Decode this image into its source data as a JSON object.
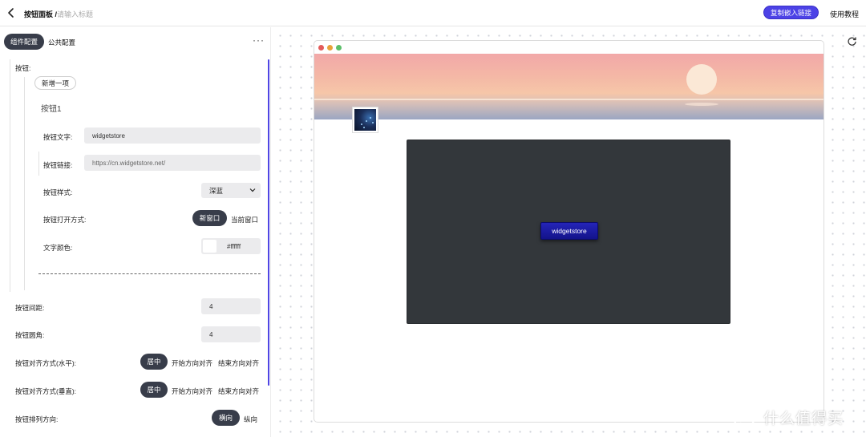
{
  "header": {
    "title": "按钮面板 /",
    "title_placeholder": "请输入标题",
    "embed_button": "复制嵌入链接",
    "tutorial_link": "使用教程"
  },
  "left_panel": {
    "tabs": [
      {
        "label": "组件配置",
        "active": true
      },
      {
        "label": "公共配置",
        "active": false
      }
    ],
    "more_icon": "ellipsis-icon",
    "buttons_label": "按钮:",
    "add_item": "新增一项",
    "item_name": "按钮1",
    "item_fields": {
      "text_label": "按钮文字:",
      "text_value": "widgetstore",
      "link_label": "按钮链接:",
      "link_value": "https://cn.widgetstore.net/",
      "style_label": "按钮样式:",
      "style_value": "深蓝",
      "open_label": "按钮打开方式:",
      "open_options": [
        "新窗口",
        "当前窗口"
      ],
      "open_selected": "新窗口",
      "color_label": "文字颜色:",
      "color_value": "#ffffff"
    },
    "spacing_label": "按钮间距:",
    "spacing_value": "4",
    "radius_label": "按钮圆角:",
    "radius_value": "4",
    "align_h_label": "按钮对齐方式(水平):",
    "align_h_options": [
      "居中",
      "开始方向对齐",
      "结束方向对齐"
    ],
    "align_h_selected": "居中",
    "align_v_label": "按钮对齐方式(垂直):",
    "align_v_options": [
      "居中",
      "开始方向对齐",
      "结束方向对齐"
    ],
    "align_v_selected": "居中",
    "direction_label": "按钮排列方向:",
    "direction_options": [
      "横向",
      "纵向"
    ],
    "direction_selected": "横向"
  },
  "preview": {
    "refresh_icon": "refresh-icon",
    "window_dots": [
      "#e35b5b",
      "#e8a23a",
      "#5cbf6a"
    ],
    "button_label": "widgetstore",
    "button_color": "#1a1aa3",
    "panel_color": "#33373b"
  },
  "watermark": {
    "text": "什么值得买",
    "logo": "smzdm-logo"
  },
  "colors": {
    "accent": "#4c42e6",
    "segment_active": "#383d4a",
    "input_bg": "#ebebed"
  }
}
